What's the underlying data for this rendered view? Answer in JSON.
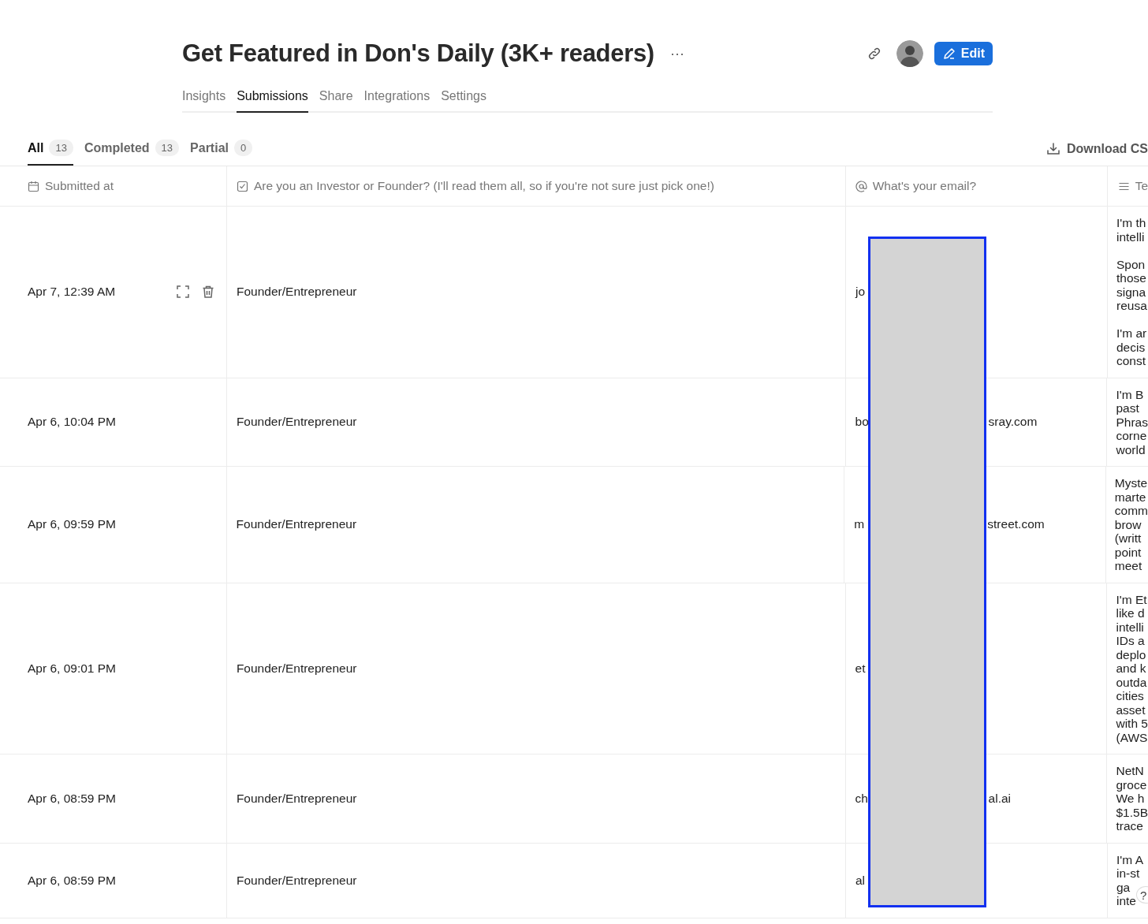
{
  "header": {
    "title": "Get Featured in Don's Daily (3K+ readers)",
    "more": "···",
    "edit_button": "Edit"
  },
  "tabs": [
    {
      "label": "Insights",
      "selected": false
    },
    {
      "label": "Submissions",
      "selected": true
    },
    {
      "label": "Share",
      "selected": false
    },
    {
      "label": "Integrations",
      "selected": false
    },
    {
      "label": "Settings",
      "selected": false
    }
  ],
  "filters": [
    {
      "label": "All",
      "count": "13",
      "selected": true
    },
    {
      "label": "Completed",
      "count": "13",
      "selected": false
    },
    {
      "label": "Partial",
      "count": "0",
      "selected": false
    }
  ],
  "download_button": "Download CS",
  "table": {
    "columns": [
      {
        "label": "Submitted at",
        "kind": "date"
      },
      {
        "label": "Are you an Investor or Founder? (I'll read them all, so if you're not sure just pick one!)",
        "kind": "choice"
      },
      {
        "label": "What's your email?",
        "kind": "email"
      },
      {
        "label": "Te",
        "kind": "text"
      }
    ],
    "rows": [
      {
        "submitted": "Apr 7, 12:39 AM",
        "actions_visible": true,
        "answer": "Founder/Entrepreneur",
        "email_start": "jo",
        "email_end": "",
        "text": [
          [
            "I'm th",
            "intelli"
          ],
          [
            "Spon",
            "those",
            "signa",
            "reusa"
          ],
          [
            "I'm ar",
            "decis",
            "const"
          ]
        ]
      },
      {
        "submitted": "Apr 6, 10:04 PM",
        "actions_visible": false,
        "answer": "Founder/Entrepreneur",
        "email_start": "bo",
        "email_end": "sray.com",
        "text": [
          [
            "I'm B",
            "past",
            "Phras",
            "corne",
            "world"
          ]
        ]
      },
      {
        "submitted": "Apr 6, 09:59 PM",
        "actions_visible": false,
        "answer": "Founder/Entrepreneur",
        "email_start": "m",
        "email_end": "street.com",
        "text": [
          [
            "Myste",
            "marte",
            "comm",
            "brow",
            "(writt",
            "point",
            "meet"
          ]
        ]
      },
      {
        "submitted": "Apr 6, 09:01 PM",
        "actions_visible": false,
        "answer": "Founder/Entrepreneur",
        "email_start": "et",
        "email_end": "",
        "text": [
          [
            "I'm Et",
            "like d",
            "intelli",
            "IDs a",
            "deplo",
            "and k",
            "outda",
            "cities",
            "asset",
            "with 5",
            "(AWS"
          ]
        ]
      },
      {
        "submitted": "Apr 6, 08:59 PM",
        "actions_visible": false,
        "answer": "Founder/Entrepreneur",
        "email_start": "ch",
        "email_end": "al.ai",
        "text": [
          [
            "NetN",
            "groce",
            "We h",
            "$1.5B",
            "trace"
          ]
        ]
      },
      {
        "submitted": "Apr 6, 08:59 PM",
        "actions_visible": false,
        "answer": "Founder/Entrepreneur",
        "email_start": "al",
        "email_end": "",
        "text": [
          [
            "I'm A",
            "in-st",
            "ga",
            "inte"
          ]
        ]
      }
    ]
  },
  "help_button": "?"
}
